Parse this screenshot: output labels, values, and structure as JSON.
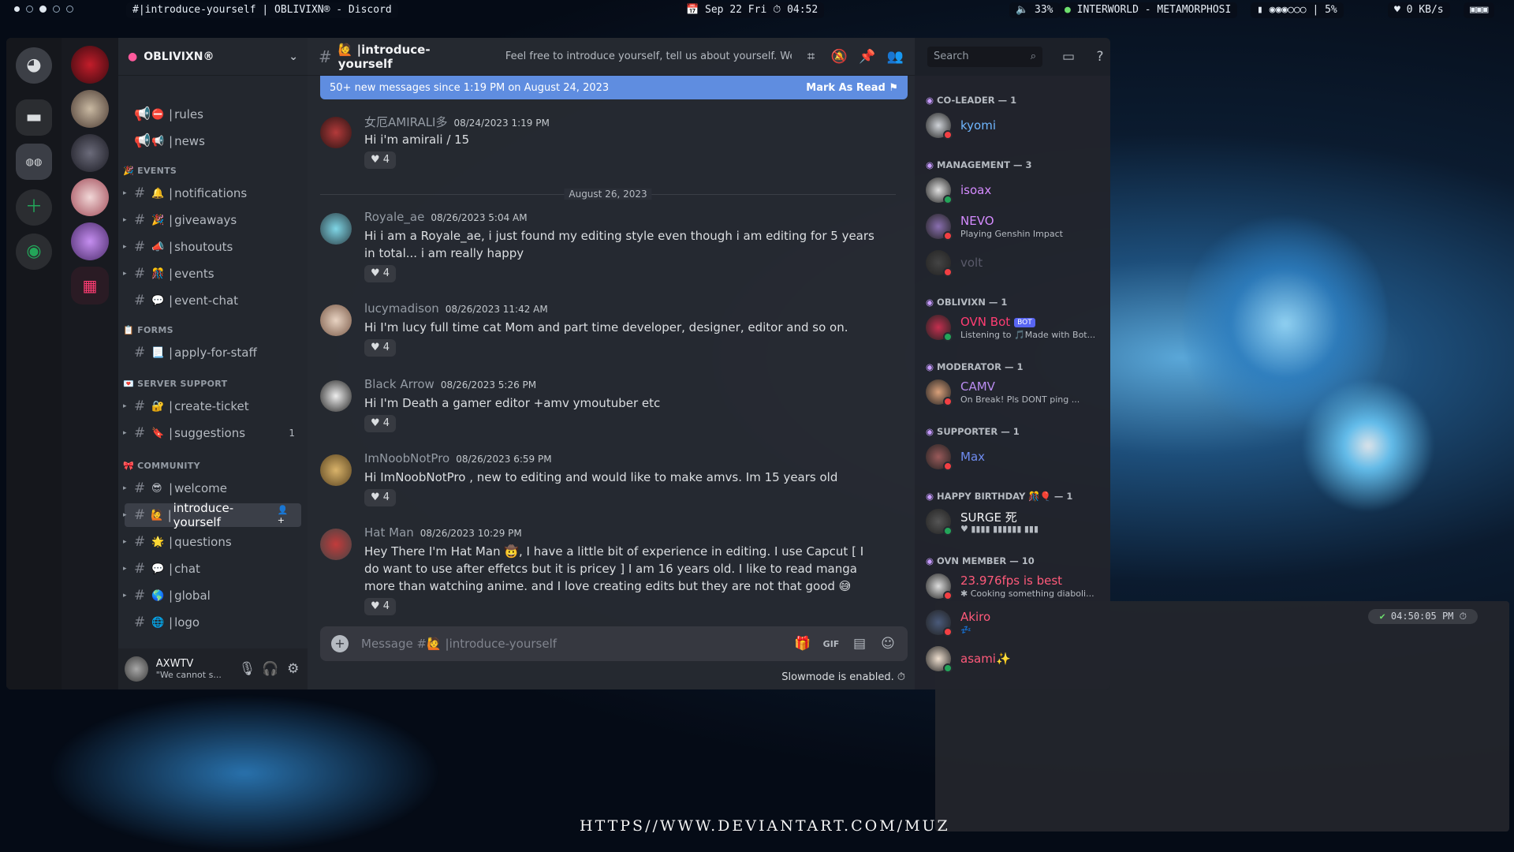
{
  "topbar": {
    "window_title": "#|introduce-yourself | OBLIVIXN® - Discord",
    "datetime": "📅 Sep 22 Fri ⏱ 04:52",
    "volume": "🔈 33%",
    "music": "INTERWORLD - METAMORPHOSI",
    "cpu": "5%",
    "net": "0 KB/s"
  },
  "server": {
    "name": "OBLIVIXN®"
  },
  "channels": {
    "top": [
      {
        "emoji": "⛔",
        "name": "rules"
      },
      {
        "emoji": "📢",
        "name": "news"
      }
    ],
    "events_label": "🎉 EVENTS",
    "events": [
      {
        "emoji": "🔔",
        "name": "notifications"
      },
      {
        "emoji": "🎉",
        "name": "giveaways"
      },
      {
        "emoji": "📣",
        "name": "shoutouts"
      },
      {
        "emoji": "🎊",
        "name": "events"
      },
      {
        "emoji": "💬",
        "name": "event-chat"
      }
    ],
    "forms_label": "📋 FORMS",
    "forms": [
      {
        "emoji": "📃",
        "name": "apply-for-staff"
      }
    ],
    "support_label": "💌 SERVER SUPPORT",
    "support": [
      {
        "emoji": "🔐",
        "name": "create-ticket"
      },
      {
        "emoji": "🔖",
        "name": "suggestions",
        "badge": "1"
      }
    ],
    "community_label": "🎀 COMMUNITY",
    "community": [
      {
        "emoji": "😎",
        "name": "welcome"
      },
      {
        "emoji": "🙋",
        "name": "introduce-yourself"
      },
      {
        "emoji": "🌟",
        "name": "questions"
      },
      {
        "emoji": "💬",
        "name": "chat"
      },
      {
        "emoji": "🌎",
        "name": "global"
      },
      {
        "emoji": "🌐",
        "name": "logo"
      }
    ]
  },
  "user": {
    "name": "AXWTV",
    "status": "\"We cannot s..."
  },
  "chat": {
    "channel_name": "🙋 |introduce-yourself",
    "topic": "Feel free to introduce yourself, tell us about yourself. We'd l...",
    "search_placeholder": "Search",
    "banner_text": "50+ new messages since 1:19 PM on August 24, 2023",
    "mark_read": "Mark As Read",
    "date_divider": "August 26, 2023",
    "messages": [
      {
        "author": "女厄AMIRALI多",
        "time": "08/24/2023 1:19 PM",
        "text": "Hi i'm amirali / 15",
        "reactions": "4"
      },
      {
        "author": "Royale_ae",
        "time": "08/26/2023 5:04 AM",
        "text": "Hi i am a Royale_ae, i just found my editing style even though i am editing for 5 years in total... i am really happy",
        "reactions": "4"
      },
      {
        "author": "lucymadison",
        "time": "08/26/2023 11:42 AM",
        "text": "Hi I'm lucy full time cat Mom and part time developer, designer, editor and so on.",
        "reactions": "4"
      },
      {
        "author": "Black Arrow",
        "time": "08/26/2023 5:26 PM",
        "text": "Hi I'm Death a gamer editor +amv ymoutuber  etc",
        "reactions": "4"
      },
      {
        "author": "ImNoobNotPro",
        "time": "08/26/2023 6:59 PM",
        "text": "Hi ImNoobNotPro , new to editing and would like to make amvs. Im 15 years old",
        "reactions": "4"
      },
      {
        "author": "Hat Man",
        "time": "08/26/2023 10:29 PM",
        "text": "Hey There I'm Hat Man 🤠, I have a little bit of experience in editing. I use Capcut [ I do want to use after effetcs but it is pricey ] I am 16 years old. I like to read manga more than watching anime. and I love creating edits but they are not that good 😅",
        "reactions": "4"
      }
    ],
    "composer_placeholder": "Message #🙋 |introduce-yourself",
    "slowmode": "Slowmode is enabled."
  },
  "members": {
    "groups": [
      {
        "role": "CO-LEADER — 1",
        "members": [
          {
            "name": "kyomi",
            "status": "",
            "color": "#6fb6ff"
          }
        ]
      },
      {
        "role": "MANAGEMENT — 3",
        "members": [
          {
            "name": "isoax",
            "status": "",
            "color": "#d58bff"
          },
          {
            "name": "NEVO",
            "status": "Playing Genshin Impact",
            "color": "#d58bff"
          },
          {
            "name": "volt",
            "status": "",
            "color": "#5a5a6a"
          }
        ]
      },
      {
        "role": "OBLIVIXN — 1",
        "members": [
          {
            "name": "OVN Bot",
            "status": "Listening to 🎵Made with Bot...",
            "color": "#ff3d73",
            "tag": "BOT"
          }
        ]
      },
      {
        "role": "MODERATOR — 1",
        "members": [
          {
            "name": "CAMV",
            "status": "On Break! Pls DONT ping ...",
            "color": "#b98cf0"
          }
        ]
      },
      {
        "role": "SUPPORTER — 1",
        "members": [
          {
            "name": "Max",
            "status": "",
            "color": "#6f8cf0"
          }
        ]
      },
      {
        "role": "HAPPY BIRTHDAY 🎊🎈 — 1",
        "members": [
          {
            "name": "SURGE 死",
            "status": "♥ ▮▮▮▮ ▮▮▮▮▮▮ ▮▮▮",
            "color": "#f2f3f5"
          }
        ]
      },
      {
        "role": "OVN MEMBER — 10",
        "members": [
          {
            "name": "23.976fps is best",
            "status": "✱ Cooking something diaboli...",
            "color": "#ff5a7a"
          },
          {
            "name": "Akiro",
            "status": "💤",
            "color": "#ff5a7a"
          },
          {
            "name": "asami✨",
            "status": "",
            "color": "#ff5a7a"
          }
        ]
      }
    ]
  },
  "terminal": {
    "clock": "04:50:05 PM"
  },
  "watermark": "HTTPS//WWW.DEVIANTART.COM/MUZ"
}
